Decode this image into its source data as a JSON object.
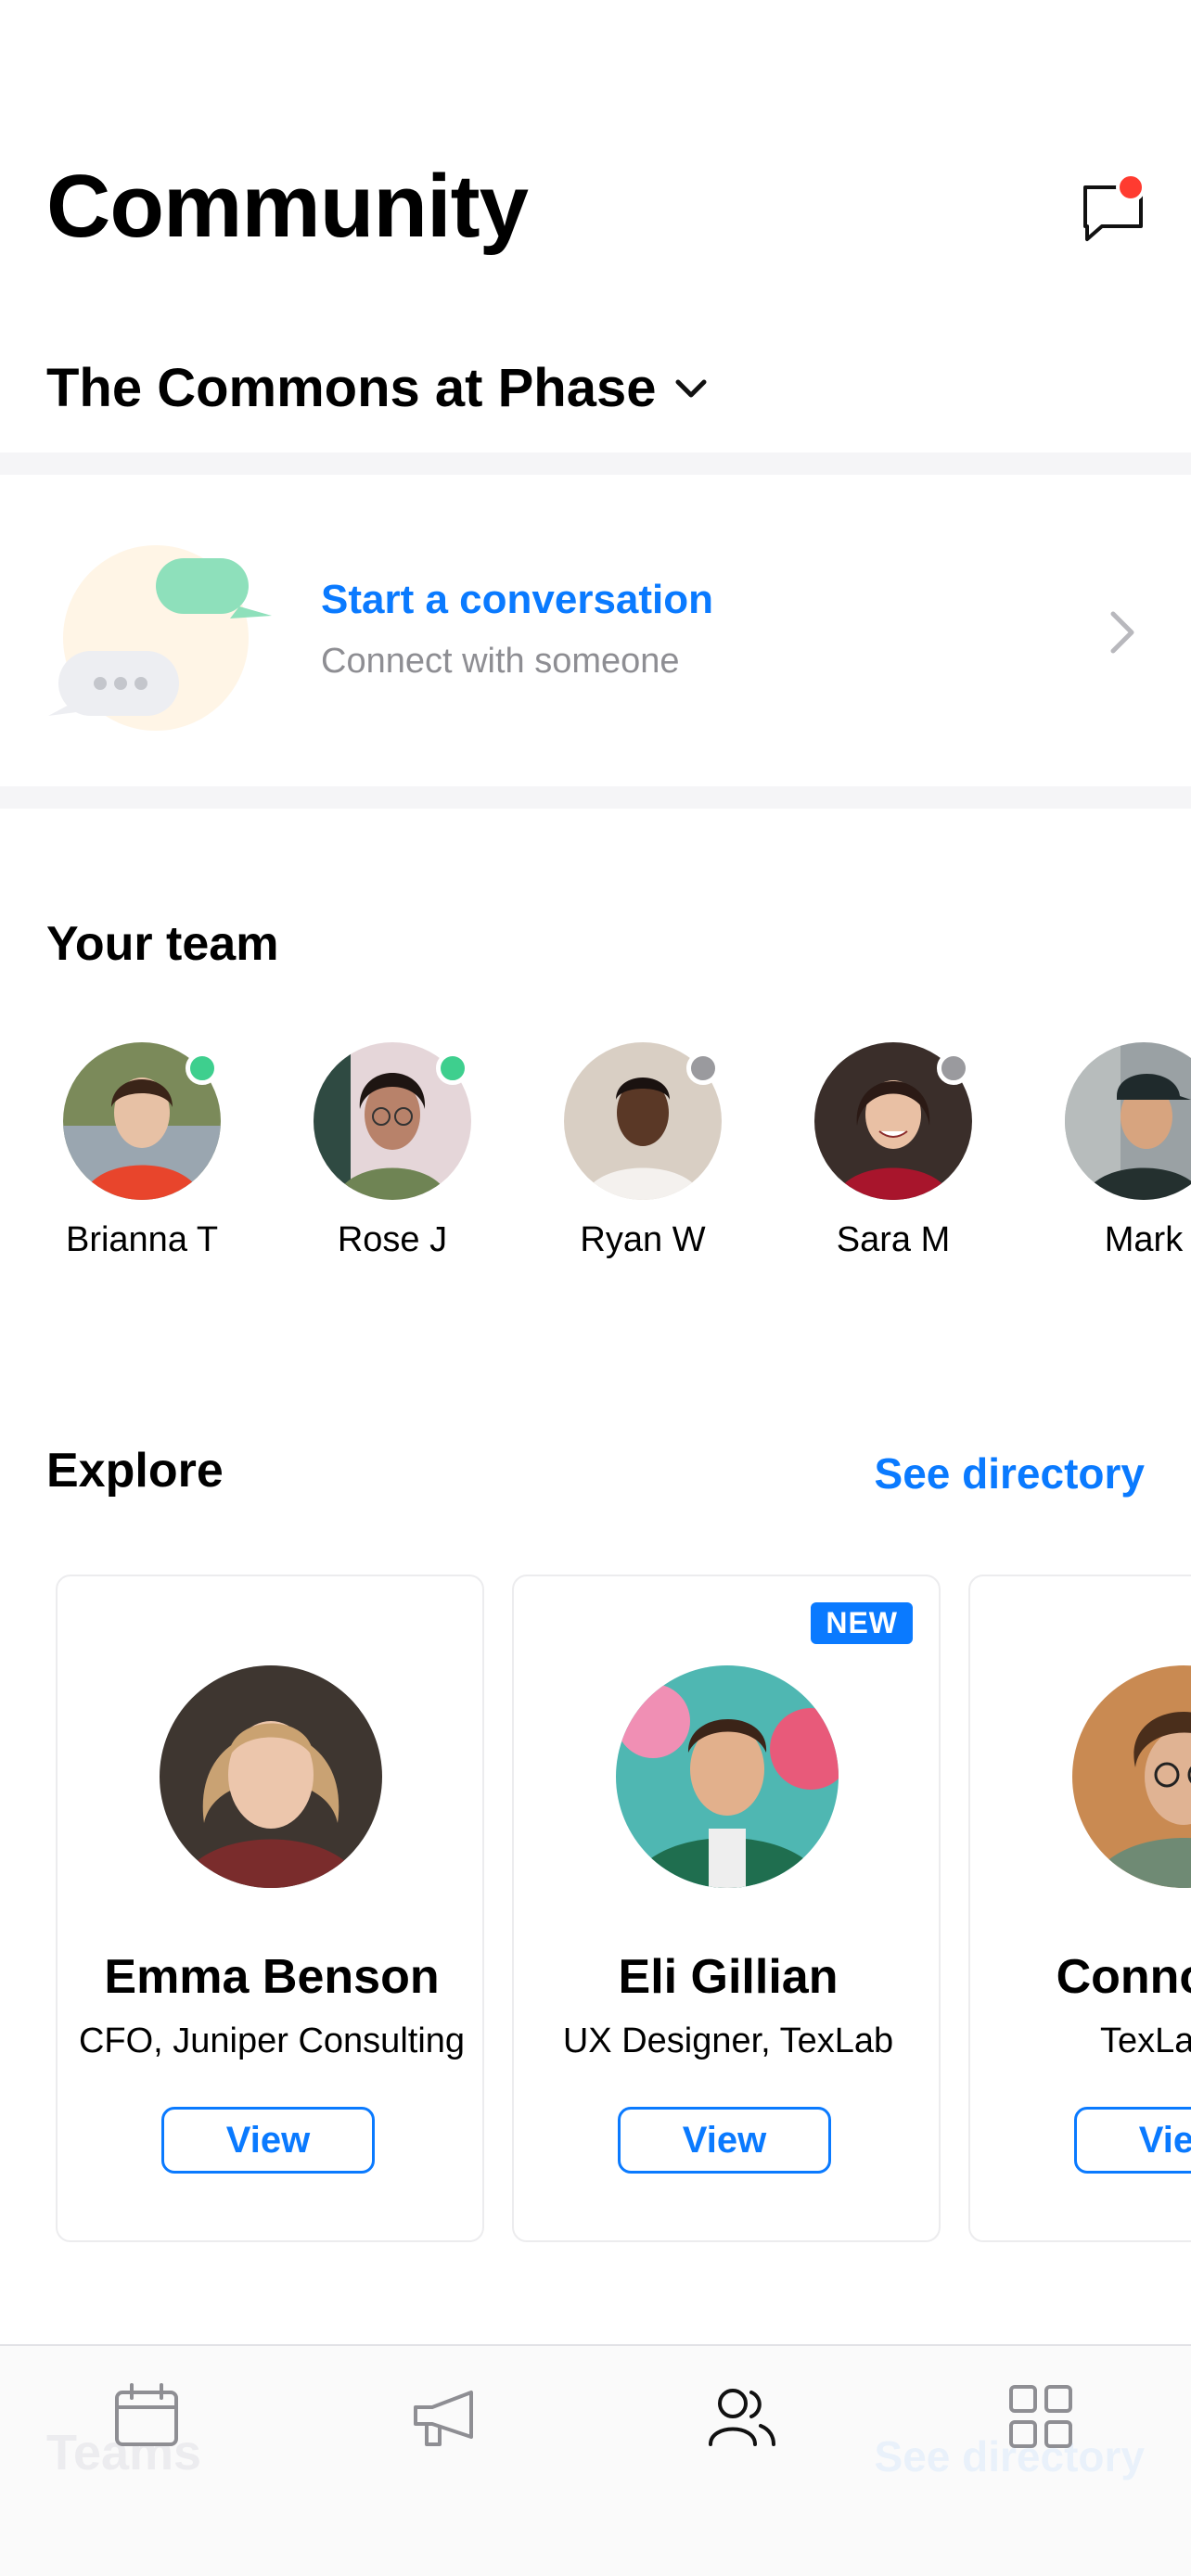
{
  "header": {
    "title": "Community",
    "community_name": "The Commons at Phase"
  },
  "conversation": {
    "title": "Start a conversation",
    "subtitle": "Connect with someone"
  },
  "team": {
    "title": "Your team",
    "members": [
      {
        "name": "Brianna T",
        "status": "online"
      },
      {
        "name": "Rose J",
        "status": "online"
      },
      {
        "name": "Ryan W",
        "status": "offline"
      },
      {
        "name": "Sara M",
        "status": "offline"
      },
      {
        "name": "Mark"
      }
    ]
  },
  "explore": {
    "title": "Explore",
    "see_directory": "See directory",
    "cards": [
      {
        "name": "Emma Benson",
        "role": "CFO, Juniper Consulting",
        "button": "View",
        "badge": ""
      },
      {
        "name": "Eli Gillian",
        "role": "UX Designer, TexLab",
        "button": "View",
        "badge": "NEW"
      },
      {
        "name": "Connor D",
        "role": "TexLab",
        "button": "View",
        "badge": ""
      }
    ]
  },
  "tabbar": {
    "ghost_left": "Teams",
    "ghost_right": "See directory",
    "tabs": [
      {
        "icon": "calendar-icon"
      },
      {
        "icon": "megaphone-icon"
      },
      {
        "icon": "people-icon",
        "active": true
      },
      {
        "icon": "grid-icon"
      }
    ]
  },
  "colors": {
    "accent": "#0a7aff",
    "online": "#3ecf8e",
    "offline": "#9a9a9e",
    "notification": "#ff3b30"
  }
}
